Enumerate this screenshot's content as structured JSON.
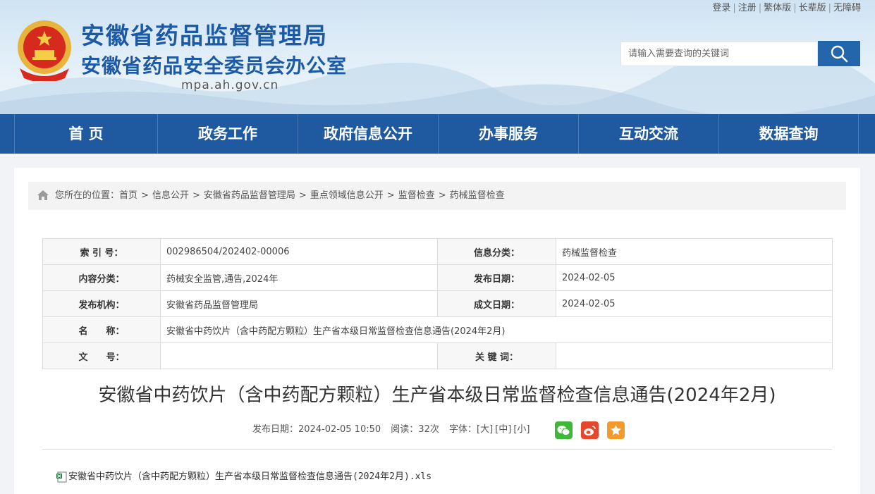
{
  "header": {
    "title_main": "安徽省药品监督管理局",
    "title_sub": "安徽省药品安全委员会办公室",
    "domain": "mpa.ah.gov.cn",
    "top_links": [
      "登录",
      "注册",
      "繁体版",
      "长辈版",
      "无障碍"
    ],
    "search": {
      "placeholder": "请输入需要查询的关键词"
    }
  },
  "nav": {
    "items": [
      "首 页",
      "政务工作",
      "政府信息公开",
      "办事服务",
      "互动交流",
      "数据查询"
    ]
  },
  "breadcrumb": {
    "prefix": "您所在的位置：",
    "items": [
      "首页",
      "信息公开",
      "安徽省药品监督管理局",
      "重点领域信息公开",
      "监督检查",
      "药械监督检查"
    ]
  },
  "info": {
    "index_label": "索 引 号：",
    "index_value": "002986504/202402-00006",
    "category_label": "信息分类：",
    "category_value": "药械监督检查",
    "content_label": "内容分类：",
    "content_value": "药械安全监管,通告,2024年",
    "publish_label": "发布日期：",
    "publish_value": "2024-02-05",
    "org_label": "发布机构：",
    "org_value": "安徽省药品监督管理局",
    "created_label": "成文日期：",
    "created_value": "2024-02-05",
    "name_label": "名　　称：",
    "name_value": "安徽省中药饮片（含中药配方颗粒）生产省本级日常监督检查信息通告(2024年2月)",
    "docno_label": "文　　号：",
    "docno_value": "",
    "keyword_label": "关 键 词：",
    "keyword_value": ""
  },
  "article": {
    "title": "安徽省中药饮片（含中药配方颗粒）生产省本级日常监督检查信息通告(2024年2月)",
    "date": "发布日期：2024-02-05 10:50",
    "reads": "阅读：32次",
    "font_prefix": "字体：",
    "font_large": "[大]",
    "font_medium": "[中]",
    "font_small": "[小]",
    "attachment": "安徽省中药饮片（含中药配方颗粒）生产省本级日常监督检查信息通告(2024年2月).xls"
  },
  "colors": {
    "brand_blue": "#1f5aa0",
    "title_blue": "#1d5aa5",
    "wechat": "#3fb837",
    "weibo": "#e6462b",
    "favorite": "#f39a2d"
  }
}
